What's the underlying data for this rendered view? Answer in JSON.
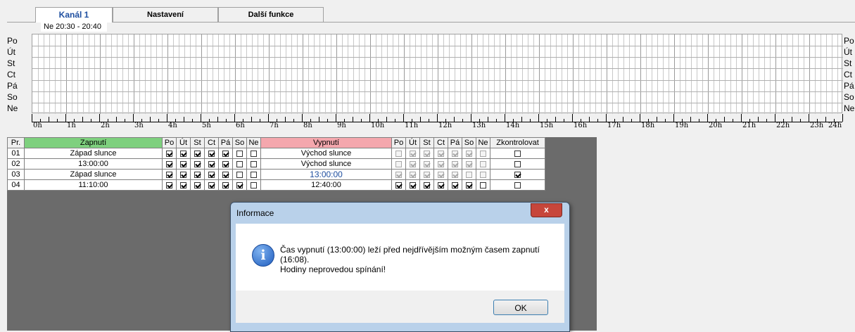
{
  "tabs": [
    {
      "label": "Kanál 1",
      "active": true
    },
    {
      "label": "Nastavení",
      "active": false
    },
    {
      "label": "Další funkce",
      "active": false
    }
  ],
  "time_range": "Ne 20:30 - 20:40",
  "days": [
    "Po",
    "Út",
    "St",
    "Ct",
    "Pá",
    "So",
    "Ne"
  ],
  "hours": [
    "0h",
    "1h",
    "2h",
    "3h",
    "4h",
    "5h",
    "6h",
    "7h",
    "8h",
    "9h",
    "10h",
    "11h",
    "12h",
    "13h",
    "14h",
    "15h",
    "16h",
    "17h",
    "18h",
    "19h",
    "20h",
    "21h",
    "22h",
    "23h",
    "24h"
  ],
  "table": {
    "headers": {
      "pr": "Pr.",
      "zapnuti": "Zapnutí",
      "vypnuti": "Vypnutí",
      "days": [
        "Po",
        "Út",
        "St",
        "Ct",
        "Pá",
        "So",
        "Ne"
      ],
      "zkontrolovat": "Zkontrolovat"
    },
    "rows": [
      {
        "pr": "01",
        "zapnuti": "Západ slunce",
        "on_days": [
          true,
          true,
          true,
          true,
          true,
          false,
          false
        ],
        "vypnuti": "Východ slunce",
        "vyp_bold": false,
        "off_days": [
          false,
          true,
          true,
          true,
          true,
          true,
          false
        ],
        "off_disabled": true,
        "check": false
      },
      {
        "pr": "02",
        "zapnuti": "13:00:00",
        "on_days": [
          true,
          true,
          true,
          true,
          true,
          false,
          false
        ],
        "vypnuti": "Východ slunce",
        "vyp_bold": false,
        "off_days": [
          false,
          true,
          true,
          true,
          true,
          true,
          false
        ],
        "off_disabled": true,
        "check": false
      },
      {
        "pr": "03",
        "zapnuti": "Západ slunce",
        "on_days": [
          true,
          true,
          true,
          true,
          true,
          false,
          false
        ],
        "vypnuti": "13:00:00",
        "vyp_bold": true,
        "off_days": [
          true,
          true,
          true,
          true,
          true,
          false,
          false
        ],
        "off_disabled": true,
        "check": true
      },
      {
        "pr": "04",
        "zapnuti": "11:10:00",
        "on_days": [
          true,
          true,
          true,
          true,
          true,
          true,
          false
        ],
        "vypnuti": "12:40:00",
        "vyp_bold": false,
        "off_days": [
          true,
          true,
          true,
          true,
          true,
          true,
          false
        ],
        "off_disabled": false,
        "check": false
      }
    ]
  },
  "dialog": {
    "title": "Informace",
    "close_label": "x",
    "line1": "Čas vypnutí (13:00:00) leží před nejdřívějším možným časem zapnutí",
    "line2": "(16:08).",
    "line3": "Hodiny neprovedou spínání!",
    "ok_label": "OK",
    "icon": "info-icon"
  }
}
